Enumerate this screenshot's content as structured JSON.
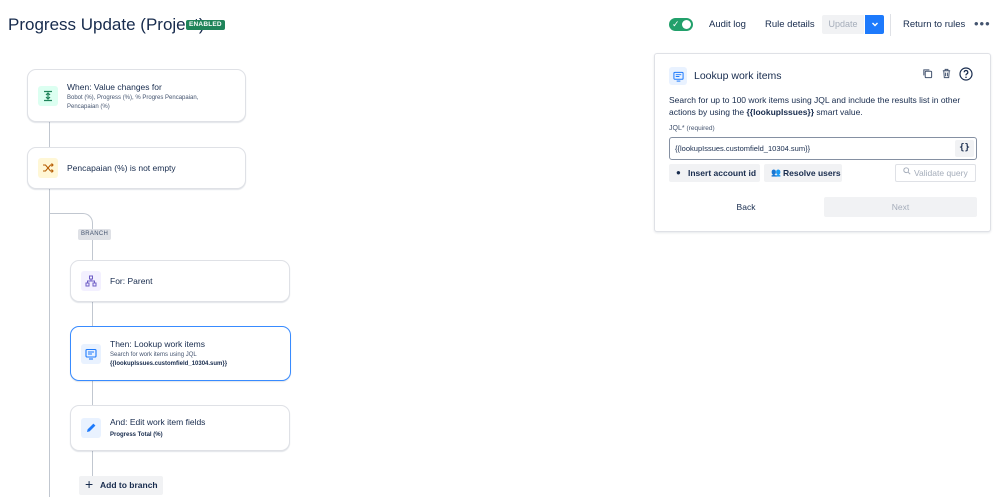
{
  "header": {
    "title": "Progress Update (Project)",
    "status": "ENABLED",
    "audit_log": "Audit log",
    "rule_details": "Rule details",
    "update": "Update",
    "return_to_rules": "Return to rules",
    "more": "•••"
  },
  "flow": {
    "trigger": {
      "title": "When: Value changes for",
      "subtitle": "Bobot (%), Progress (%), % Progres Pencapaian, Pencapaian (%)",
      "icon": "value-change-icon"
    },
    "condition": {
      "title": "Pencapaian (%) is not empty",
      "icon": "shuffle-icon"
    },
    "branch_label": "BRANCH",
    "branch_for": {
      "title": "For: Parent",
      "icon": "hierarchy-icon"
    },
    "lookup": {
      "title": "Then: Lookup work items",
      "subtitle": "Search for work items using JQL",
      "value": "{{lookupIssues.customfield_10304.sum}}",
      "icon": "lookup-icon"
    },
    "edit": {
      "title": "And: Edit work item fields",
      "value": "Progress Total (%)",
      "icon": "pencil-icon"
    },
    "add_to_branch": "Add to branch"
  },
  "panel": {
    "title": "Lookup work items",
    "description_pre": "Search for up to 100 work items using JQL and include the results list in other actions by using the ",
    "description_smart": "{{lookupIssues}}",
    "description_post": " smart value.",
    "jql_label": "JQL*",
    "jql_required": "(required)",
    "jql_value": "{{lookupIssues.customfield_10304.sum}}",
    "smart_value_button": "{}",
    "insert_account_id": "Insert account id",
    "resolve_users": "Resolve users",
    "validate_query": "Validate query",
    "back": "Back",
    "next": "Next"
  },
  "colors": {
    "enabled_green": "#1f845a",
    "toggle_green": "#22a06b",
    "primary_blue": "#1d7afc",
    "selected_border": "#388bff"
  }
}
